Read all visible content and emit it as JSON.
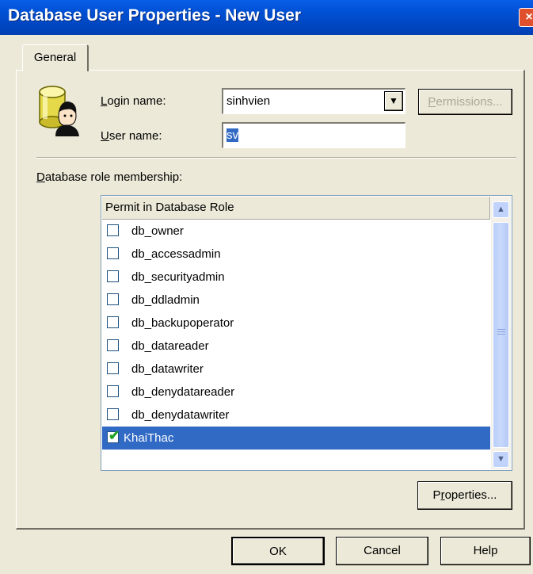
{
  "window": {
    "title": "Database User Properties - New User",
    "close_glyph": "×"
  },
  "tabs": [
    {
      "label": "General"
    }
  ],
  "form": {
    "login_label": "Login name:",
    "login_accel": "L",
    "login_rest": "ogin name:",
    "login_value": "sinhvien",
    "permissions_label": "Permissions...",
    "permissions_accel": "P",
    "permissions_rest": "ermissions...",
    "user_label": "User name:",
    "user_accel": "U",
    "user_rest": "ser name:",
    "user_value": "sv"
  },
  "roles": {
    "section_label": "Database role membership:",
    "section_accel": "D",
    "section_rest": "atabase role membership:",
    "column_header": "Permit in Database Role",
    "items": [
      {
        "label": "db_owner",
        "checked": false,
        "selected": false
      },
      {
        "label": "db_accessadmin",
        "checked": false,
        "selected": false
      },
      {
        "label": "db_securityadmin",
        "checked": false,
        "selected": false
      },
      {
        "label": "db_ddladmin",
        "checked": false,
        "selected": false
      },
      {
        "label": "db_backupoperator",
        "checked": false,
        "selected": false
      },
      {
        "label": "db_datareader",
        "checked": false,
        "selected": false
      },
      {
        "label": "db_datawriter",
        "checked": false,
        "selected": false
      },
      {
        "label": "db_denydatareader",
        "checked": false,
        "selected": false
      },
      {
        "label": "db_denydatawriter",
        "checked": false,
        "selected": false
      },
      {
        "label": "KhaiThac",
        "checked": true,
        "selected": true
      }
    ],
    "properties_label": "Properties...",
    "properties_accel": "r",
    "properties_pre": "P",
    "properties_rest": "operties..."
  },
  "footer": {
    "ok_label": "OK",
    "cancel_label": "Cancel",
    "help_label": "Help"
  },
  "colors": {
    "title_bar": "#0052d6",
    "selection": "#316ac5",
    "dialog_bg": "#ece9d8",
    "check_mark": "#21a121"
  },
  "icons": [
    "close-icon",
    "user-database-icon",
    "dropdown-arrow-icon",
    "scroll-up-icon",
    "scroll-down-icon",
    "checkmark-icon"
  ]
}
